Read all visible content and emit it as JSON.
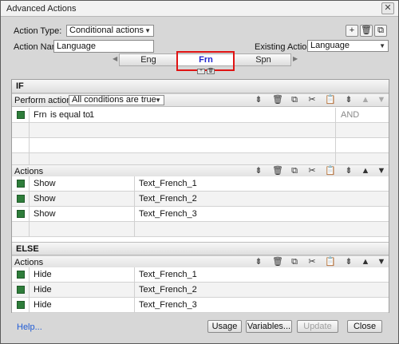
{
  "window": {
    "title": "Advanced Actions",
    "close_symbol": "✕"
  },
  "form": {
    "action_type_label": "Action Type:",
    "action_type_value": "Conditional actions",
    "action_name_label": "Action Name:",
    "action_name_value": "Language",
    "existing_actions_label": "Existing Actions:",
    "existing_actions_value": "Language"
  },
  "tabs": [
    {
      "label": "Eng",
      "active": false
    },
    {
      "label": "Frn",
      "active": true
    },
    {
      "label": "Spn",
      "active": false
    }
  ],
  "if_section": {
    "heading": "IF",
    "perform_label": "Perform action if:",
    "perform_value": "All conditions are true",
    "conditions": [
      {
        "left": "Frn",
        "operator": "is equal to",
        "right": "1",
        "logic": "AND"
      }
    ]
  },
  "actions_section": {
    "heading": "Actions",
    "rows": [
      {
        "verb": "Show",
        "target": "Text_French_1"
      },
      {
        "verb": "Show",
        "target": "Text_French_2"
      },
      {
        "verb": "Show",
        "target": "Text_French_3"
      }
    ]
  },
  "else_section": {
    "heading": "ELSE",
    "actions_heading": "Actions",
    "rows": [
      {
        "verb": "Hide",
        "target": "Text_French_1"
      },
      {
        "verb": "Hide",
        "target": "Text_French_2"
      },
      {
        "verb": "Hide",
        "target": "Text_French_3"
      }
    ]
  },
  "footer": {
    "help": "Help...",
    "usage": "Usage",
    "variables": "Variables...",
    "update": "Update",
    "close": "Close"
  },
  "icons": {
    "add": "+",
    "delete": "🗑",
    "copy": "⧉",
    "cut": "✂",
    "paste": "📋",
    "insert": "⇟",
    "up": "▲",
    "down": "▼",
    "combo_arrow": "▼",
    "tab_left": "◀",
    "tab_right": "▶"
  }
}
